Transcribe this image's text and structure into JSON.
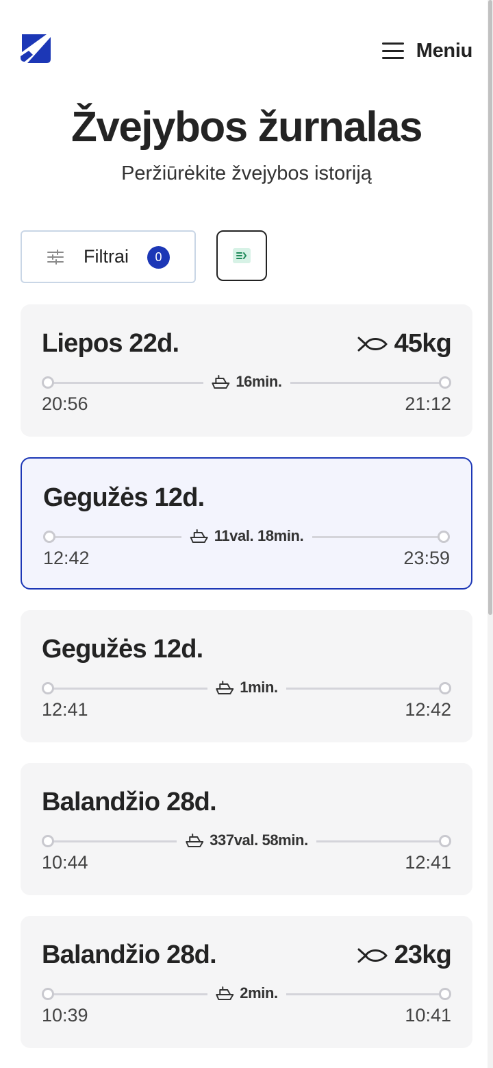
{
  "header": {
    "menu_label": "Meniu",
    "brand_color": "#1c37b6"
  },
  "page": {
    "title": "Žvejybos žurnalas",
    "subtitle": "Peržiūrėkite žvejybos istoriją"
  },
  "toolbar": {
    "filter_label": "Filtrai",
    "filter_count": "0",
    "filter_icon": "sliders-icon",
    "sort_icon": "sort-icon"
  },
  "trips": [
    {
      "date": "Liepos 22d.",
      "weight": "45kg",
      "duration": "16min.",
      "start": "20:56",
      "end": "21:12",
      "selected": false
    },
    {
      "date": "Gegužės 12d.",
      "weight": "",
      "duration": "11val. 18min.",
      "start": "12:42",
      "end": "23:59",
      "selected": true
    },
    {
      "date": "Gegužės 12d.",
      "weight": "",
      "duration": "1min.",
      "start": "12:41",
      "end": "12:42",
      "selected": false
    },
    {
      "date": "Balandžio 28d.",
      "weight": "",
      "duration": "337val. 58min.",
      "start": "10:44",
      "end": "12:41",
      "selected": false
    },
    {
      "date": "Balandžio 28d.",
      "weight": "23kg",
      "duration": "2min.",
      "start": "10:39",
      "end": "10:41",
      "selected": false
    }
  ]
}
